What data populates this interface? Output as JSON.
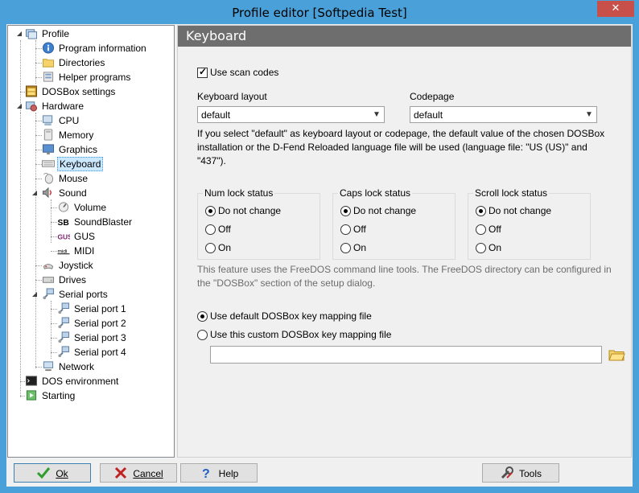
{
  "window": {
    "title": "Profile editor [Softpedia Test]",
    "close_glyph": "✕"
  },
  "tree": {
    "items": [
      {
        "label": "Profile"
      },
      {
        "label": "Program information"
      },
      {
        "label": "Directories"
      },
      {
        "label": "Helper programs"
      },
      {
        "label": "DOSBox settings"
      },
      {
        "label": "Hardware"
      },
      {
        "label": "CPU"
      },
      {
        "label": "Memory"
      },
      {
        "label": "Graphics"
      },
      {
        "label": "Keyboard"
      },
      {
        "label": "Mouse"
      },
      {
        "label": "Sound"
      },
      {
        "label": "Volume"
      },
      {
        "label": "SoundBlaster"
      },
      {
        "label": "GUS"
      },
      {
        "label": "MIDI"
      },
      {
        "label": "Joystick"
      },
      {
        "label": "Drives"
      },
      {
        "label": "Serial ports"
      },
      {
        "label": "Serial port 1"
      },
      {
        "label": "Serial port 2"
      },
      {
        "label": "Serial port 3"
      },
      {
        "label": "Serial port 4"
      },
      {
        "label": "Network"
      },
      {
        "label": "DOS environment"
      },
      {
        "label": "Starting"
      }
    ],
    "selected": "Keyboard"
  },
  "panel": {
    "header": "Keyboard",
    "use_scan_codes": {
      "label": "Use scan codes",
      "checked": true
    },
    "keyboard_layout": {
      "label": "Keyboard layout",
      "value": "default"
    },
    "codepage": {
      "label": "Codepage",
      "value": "default"
    },
    "info_text": "If you select \"default\" as keyboard layout or codepage, the default value of the chosen DOSBox installation or the D-Fend Reloaded language file will be used (language file: \"US (US)\" and \"437\").",
    "groups": [
      {
        "title": "Num lock status",
        "options": [
          "Do not change",
          "Off",
          "On"
        ],
        "selected": "Do not change"
      },
      {
        "title": "Caps lock status",
        "options": [
          "Do not change",
          "Off",
          "On"
        ],
        "selected": "Do not change"
      },
      {
        "title": "Scroll lock status",
        "options": [
          "Do not change",
          "Off",
          "On"
        ],
        "selected": "Do not change"
      }
    ],
    "freedos_note": "This feature uses the FreeDOS command line tools. The FreeDOS directory can be configured in the \"DOSBox\" section of the setup dialog.",
    "mapping": {
      "default_label": "Use default DOSBox key mapping file",
      "custom_label": "Use this custom DOSBox key mapping file",
      "selected": "default",
      "path_value": ""
    }
  },
  "buttons": {
    "ok": "Ok",
    "cancel": "Cancel",
    "help": "Help",
    "tools": "Tools"
  },
  "colors": {
    "title_bar": "#4aa0d8",
    "close_button": "#c7504a",
    "panel_header": "#6e6e6e",
    "selection": "#cce8ff"
  }
}
